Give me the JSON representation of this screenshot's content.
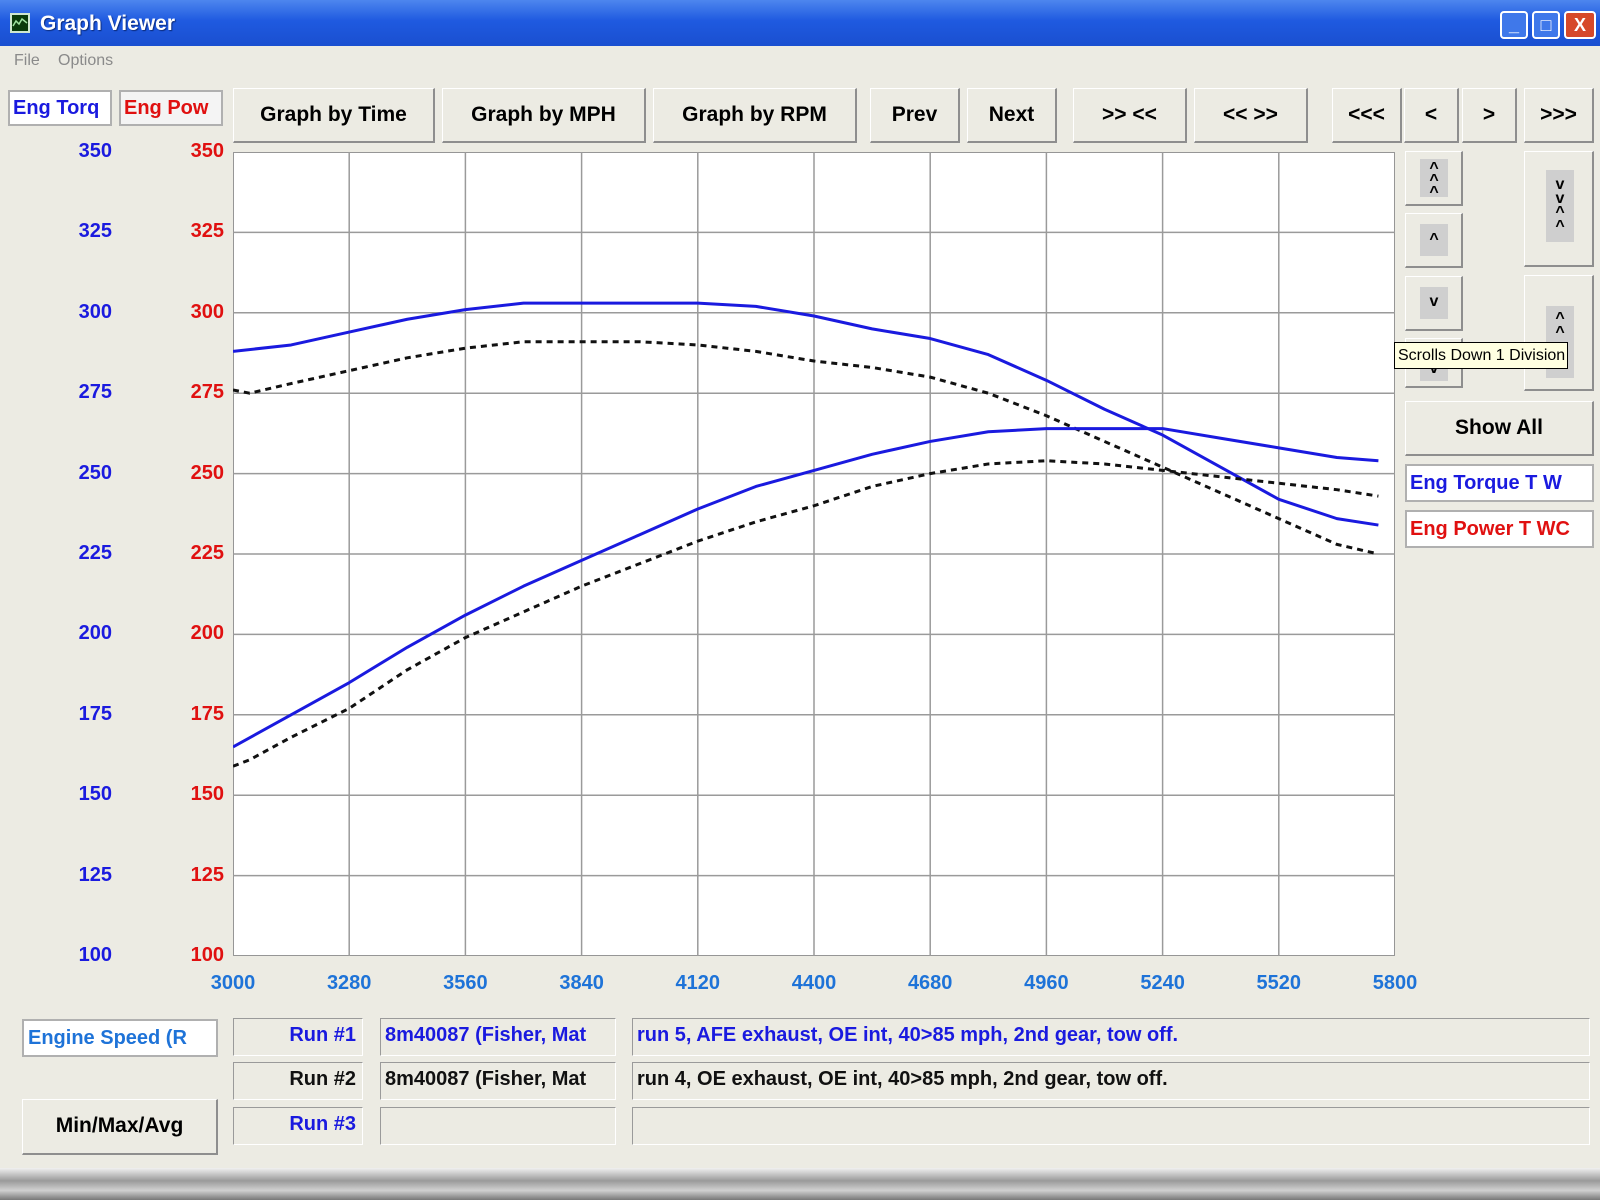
{
  "window": {
    "title": "Graph Viewer",
    "controls": {
      "minimize": "_",
      "maximize": "□",
      "close": "X"
    }
  },
  "menu": [
    "File",
    "Options"
  ],
  "legend_tabs": {
    "torque": "Eng Torq",
    "power": "Eng Pow"
  },
  "toolbar": {
    "graph_by_time": "Graph by Time",
    "graph_by_mph": "Graph by MPH",
    "graph_by_rpm": "Graph by RPM",
    "prev": "Prev",
    "next": "Next",
    "zoom_in": ">> <<",
    "zoom_out": "<< >>",
    "scroll_far_left": "<<<",
    "scroll_left": "<",
    "scroll_right": ">",
    "scroll_far_right": ">>>"
  },
  "side_panel": {
    "show_all": "Show All",
    "legend_torque": "Eng Torque T W",
    "legend_power": "Eng Power T WC",
    "tooltip": "Scrolls Down 1 Division",
    "icons": {
      "up_far": "double-chevron-up-icon",
      "up": "chevron-up-icon",
      "down": "chevron-down-icon",
      "down_far": "double-chevron-down-icon"
    }
  },
  "bottom": {
    "x_axis_field": "Engine Speed (R",
    "min_max_avg": "Min/Max/Avg",
    "runs": [
      {
        "label": "Run #1",
        "file": "8m40087 (Fisher, Mat",
        "desc": "run 5, AFE exhaust, OE int, 40>85 mph, 2nd gear, tow off."
      },
      {
        "label": "Run #2",
        "file": "8m40087 (Fisher, Mat",
        "desc": "run 4, OE exhaust, OE int, 40>85 mph, 2nd gear, tow off."
      },
      {
        "label": "Run #3",
        "file": "",
        "desc": ""
      }
    ]
  },
  "colors": {
    "torque_axis": "#1a1adf",
    "power_axis": "#e01010",
    "x_axis": "#1e73d8",
    "run1": "#1a1adf",
    "run2": "#111111",
    "run_label_blue": "#1a1adf"
  },
  "chart_data": {
    "type": "line",
    "x_ticks": [
      3000,
      3280,
      3560,
      3840,
      4120,
      4400,
      4680,
      4960,
      5240,
      5520,
      5800
    ],
    "y_ticks_torque": [
      100,
      125,
      150,
      175,
      200,
      225,
      250,
      275,
      300,
      325,
      350
    ],
    "y_ticks_power": [
      100,
      125,
      150,
      175,
      200,
      225,
      250,
      275,
      300,
      325,
      350
    ],
    "xlim": [
      3000,
      5800
    ],
    "ylim": [
      100,
      350
    ],
    "grid": true,
    "series": [
      {
        "name": "Eng Torque T W",
        "run": "Run #1",
        "style": "solid",
        "x": [
          3000,
          3140,
          3280,
          3420,
          3560,
          3700,
          3840,
          3980,
          4120,
          4260,
          4400,
          4540,
          4680,
          4820,
          4960,
          5100,
          5240,
          5380,
          5520,
          5660,
          5760
        ],
        "y": [
          288,
          290,
          294,
          298,
          301,
          303,
          303,
          303,
          303,
          302,
          299,
          295,
          292,
          287,
          279,
          270,
          262,
          252,
          242,
          236,
          234
        ]
      },
      {
        "name": "Eng Torque T W",
        "run": "Run #2",
        "style": "dashed",
        "x": [
          3000,
          3040,
          3140,
          3280,
          3420,
          3560,
          3700,
          3840,
          3980,
          4120,
          4260,
          4400,
          4540,
          4680,
          4820,
          4960,
          5100,
          5240,
          5380,
          5520,
          5660,
          5760
        ],
        "y": [
          276,
          275,
          278,
          282,
          286,
          289,
          291,
          291,
          291,
          290,
          288,
          285,
          283,
          280,
          275,
          268,
          260,
          252,
          244,
          236,
          228,
          225
        ]
      },
      {
        "name": "Eng Power T WC",
        "run": "Run #1",
        "style": "solid",
        "x": [
          3000,
          3140,
          3280,
          3420,
          3560,
          3700,
          3840,
          3980,
          4120,
          4260,
          4400,
          4540,
          4680,
          4820,
          4960,
          5100,
          5240,
          5380,
          5520,
          5660,
          5760
        ],
        "y": [
          165,
          175,
          185,
          196,
          206,
          215,
          223,
          231,
          239,
          246,
          251,
          256,
          260,
          263,
          264,
          264,
          264,
          261,
          258,
          255,
          254
        ]
      },
      {
        "name": "Eng Power T WC",
        "run": "Run #2",
        "style": "dashed",
        "x": [
          3000,
          3040,
          3140,
          3280,
          3420,
          3560,
          3700,
          3840,
          3980,
          4120,
          4260,
          4400,
          4540,
          4680,
          4820,
          4960,
          5100,
          5240,
          5380,
          5520,
          5660,
          5760
        ],
        "y": [
          159,
          161,
          168,
          177,
          189,
          199,
          207,
          215,
          222,
          229,
          235,
          240,
          246,
          250,
          253,
          254,
          253,
          251,
          249,
          247,
          245,
          243
        ]
      }
    ]
  }
}
